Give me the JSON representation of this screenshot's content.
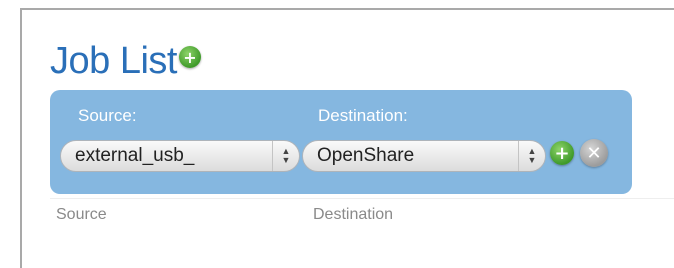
{
  "page": {
    "title": "Job List"
  },
  "icons": {
    "add": "plus",
    "remove": "x"
  },
  "filter": {
    "source_label": "Source:",
    "destination_label": "Destination:",
    "source_value": "external_usb_",
    "destination_value": "OpenShare"
  },
  "table": {
    "columns": [
      "Source",
      "Destination"
    ]
  },
  "colors": {
    "title": "#2a6fb8",
    "panel": "#85b7e0",
    "add_button": "#4caa30",
    "remove_button": "#a8a8a8"
  }
}
